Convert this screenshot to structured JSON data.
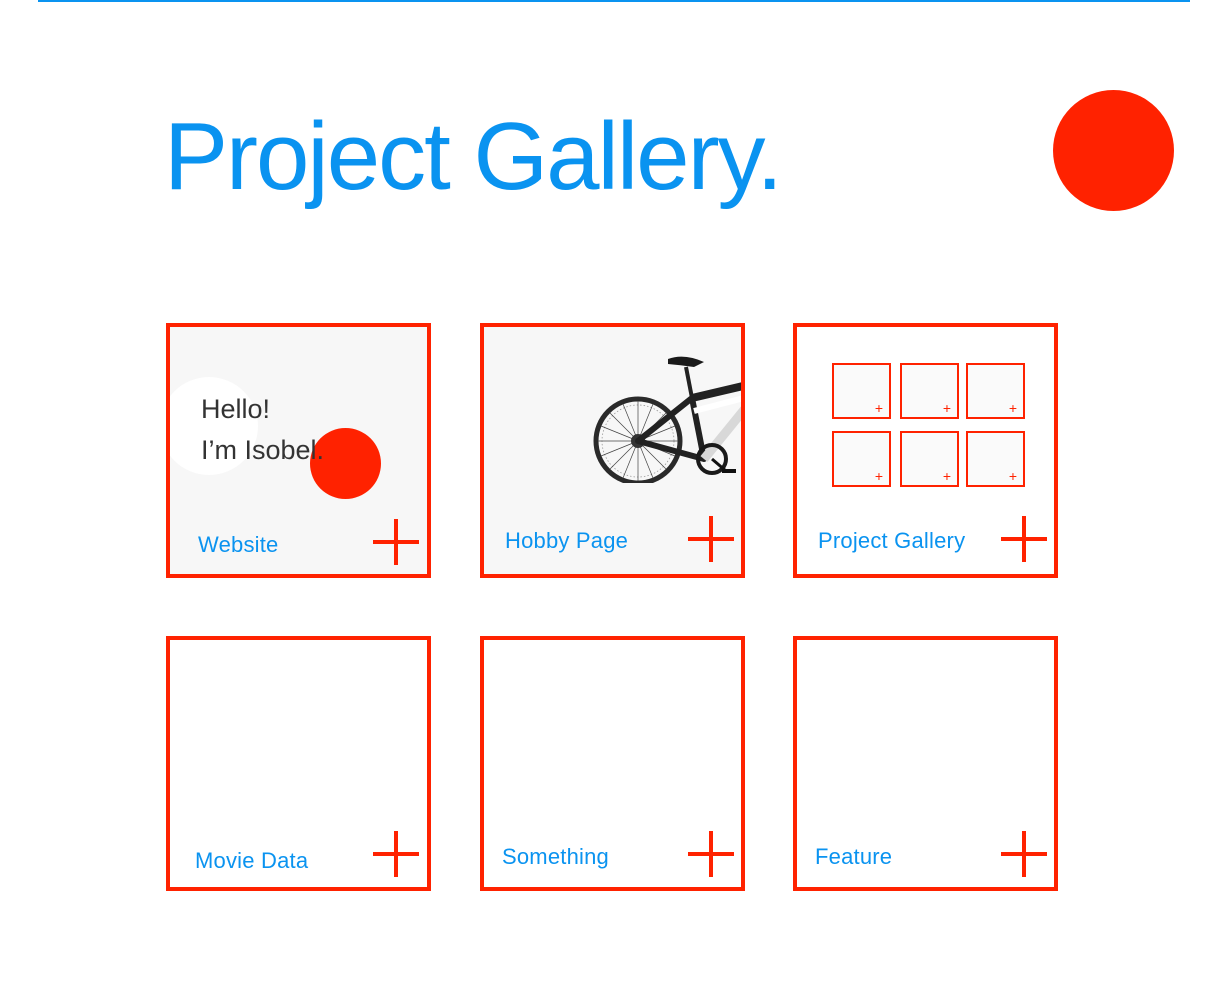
{
  "title": "Project Gallery.",
  "colors": {
    "accent": "#0a93f0",
    "highlight": "#ff2200",
    "card_bg": "#f7f7f7"
  },
  "icons": {
    "card_action": "plus-icon",
    "hobby_preview": "bicycle-icon"
  },
  "website_preview": {
    "line1": "Hello!",
    "line2": "I’m Isobel."
  },
  "gallery_preview": {
    "mini_cards": [
      "+",
      "+",
      "+",
      "+",
      "+",
      "+"
    ]
  },
  "projects": [
    {
      "label": "Website"
    },
    {
      "label": "Hobby Page"
    },
    {
      "label": "Project Gallery"
    },
    {
      "label": "Movie Data"
    },
    {
      "label": "Something"
    },
    {
      "label": "Feature"
    }
  ]
}
